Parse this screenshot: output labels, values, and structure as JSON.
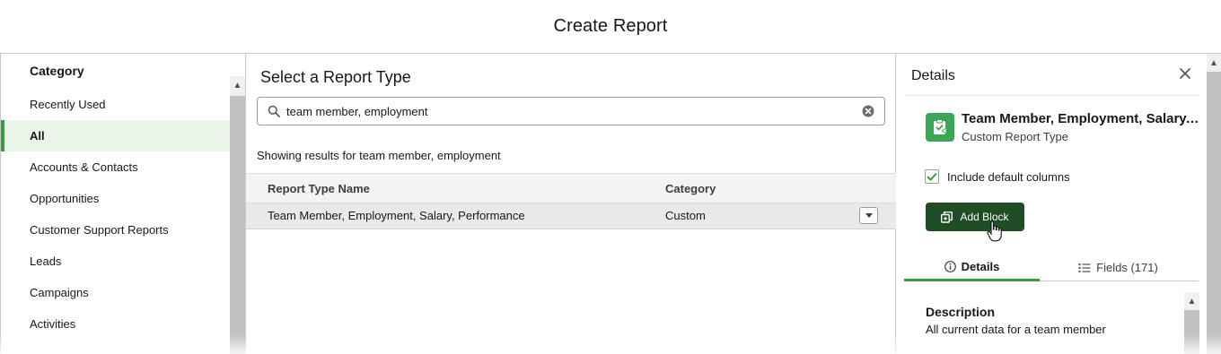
{
  "header": {
    "title": "Create Report"
  },
  "category_panel": {
    "title": "Category",
    "items": [
      {
        "label": "Recently Used",
        "selected": false
      },
      {
        "label": "All",
        "selected": true
      },
      {
        "label": "Accounts & Contacts",
        "selected": false
      },
      {
        "label": "Opportunities",
        "selected": false
      },
      {
        "label": "Customer Support Reports",
        "selected": false
      },
      {
        "label": "Leads",
        "selected": false
      },
      {
        "label": "Campaigns",
        "selected": false
      },
      {
        "label": "Activities",
        "selected": false
      }
    ]
  },
  "report_type_panel": {
    "title": "Select a Report Type",
    "search": {
      "value": "team member, employment"
    },
    "results_text": "Showing results for team member, employment",
    "columns": [
      "Report Type Name",
      "Category"
    ],
    "rows": [
      {
        "name": "Team Member, Employment, Salary, Performance",
        "category": "Custom"
      }
    ]
  },
  "details_panel": {
    "title": "Details",
    "report_type_name": "Team Member, Employment, Salary, Performance",
    "report_type_kind": "Custom Report Type",
    "include_default_columns": {
      "label": "Include default columns",
      "checked": true
    },
    "add_button_label": "Add Block",
    "tabs": [
      {
        "label": "Details",
        "active": true
      },
      {
        "label": "Fields (171)",
        "active": false
      }
    ],
    "description_heading": "Description",
    "description_text": "All current data for a team member"
  },
  "colors": {
    "accent_green": "#3a9c3c",
    "button_dark_green": "#1f4d25",
    "icon_green": "#3ba755",
    "selected_bg": "#eaf4e8"
  }
}
